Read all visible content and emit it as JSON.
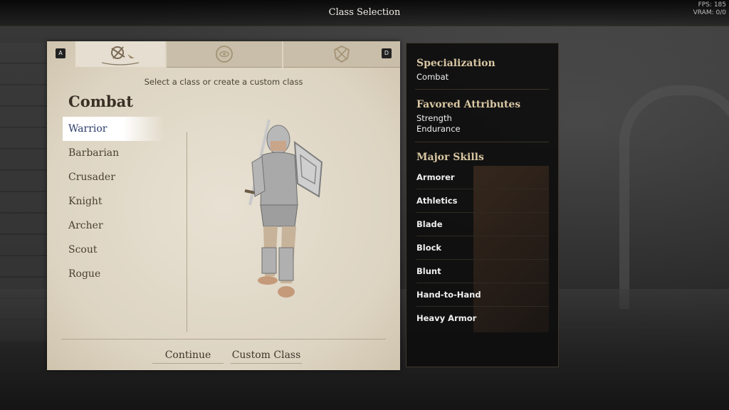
{
  "header": {
    "title": "Class Selection"
  },
  "stats": {
    "fps": "FPS: 185",
    "vram": "VRAM: 0/0"
  },
  "tabs": [
    {
      "key": "A",
      "icon": "combat-crest-icon",
      "active": true
    },
    {
      "icon": "magic-eye-icon",
      "active": false
    },
    {
      "key": "D",
      "icon": "stealth-crest-icon",
      "active": false
    }
  ],
  "panel": {
    "subtitle": "Select a class or create a custom class",
    "category": "Combat",
    "classes": [
      "Warrior",
      "Barbarian",
      "Crusader",
      "Knight",
      "Archer",
      "Scout",
      "Rogue"
    ],
    "selected": "Warrior",
    "continue_label": "Continue",
    "custom_label": "Custom Class"
  },
  "info": {
    "specialization_label": "Specialization",
    "specialization_value": "Combat",
    "attributes_label": "Favored Attributes",
    "attributes": [
      "Strength",
      "Endurance"
    ],
    "skills_label": "Major Skills",
    "skills": [
      "Armorer",
      "Athletics",
      "Blade",
      "Block",
      "Blunt",
      "Hand-to-Hand",
      "Heavy Armor"
    ]
  }
}
